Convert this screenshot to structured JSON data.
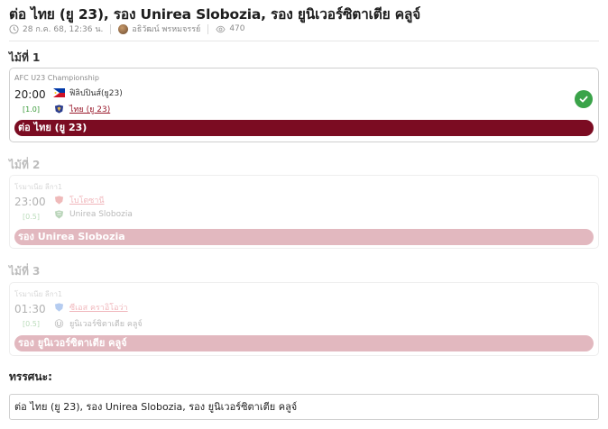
{
  "article": {
    "title": "ต่อ ไทย (ยู 23), รอง Unirea Slobozia, รอง ยูนิเวอร์ซิตาเตีย คลูจ์",
    "date": "28 ก.ค. 68, 12:36 น.",
    "author": "อธิวัฒน์ พรหมจรรย์",
    "views": "470"
  },
  "matches": [
    {
      "label": "ไม้ที่ 1",
      "league": "AFC U23 Championship",
      "time": "20:00",
      "odds": "[1.0]",
      "home": "ฟิลิปปินส์(ยู23)",
      "away": "ไทย (ยู 23)",
      "pick": "ต่อ ไทย (ยู 23)",
      "result_icon": "check-circle-icon"
    },
    {
      "label": "ไม้ที่ 2",
      "league": "โรมาเนีย ลีกา1",
      "time": "23:00",
      "odds": "[0.5]",
      "home": "โบโตซานี",
      "away": "Unirea Slobozia",
      "pick": "รอง Unirea Slobozia"
    },
    {
      "label": "ไม้ที่ 3",
      "league": "โรมาเนีย ลีกา1",
      "time": "01:30",
      "odds": "[0.5]",
      "home": "ซีเอส คราอิโอว่า",
      "away": "ยูนิเวอร์ซิตาเตีย คลูจ์",
      "pick": "รอง ยูนิเวอร์ซิตาเตีย คลูจ์"
    }
  ],
  "opinion": {
    "label": "ทรรศนะ:",
    "text": "ต่อ ไทย (ยู 23), รอง Unirea Slobozia, รอง ยูนิเวอร์ซิตาเตีย คลูจ์"
  },
  "colors": {
    "accent": "#7b0c22",
    "accent_faded": "#e2b8bf",
    "success": "#3aa349"
  }
}
